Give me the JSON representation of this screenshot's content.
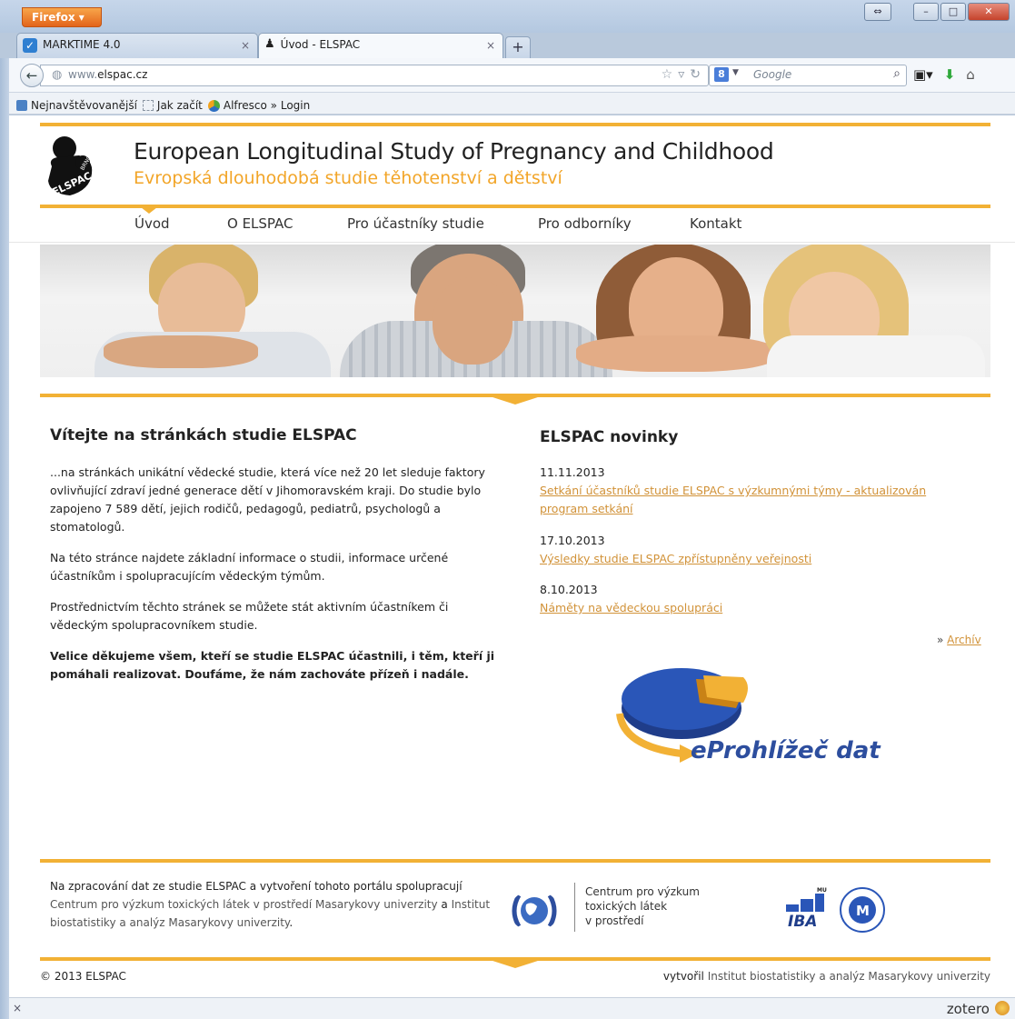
{
  "browser": {
    "app_button": "Firefox",
    "tabs": [
      {
        "label": "MARKTIME 4.0",
        "active": false
      },
      {
        "label": "Úvod - ELSPAC",
        "active": true
      }
    ],
    "new_tab": "+",
    "url_prefix": "www.",
    "url_domain": "elspac.cz",
    "search_placeholder": "Google",
    "bookmarks": [
      "Nejnavštěvovanější",
      "Jak začít",
      "Alfresco » Login"
    ],
    "status_left": "×",
    "status_right": "zotero"
  },
  "site": {
    "logo_text": "ELSPAC BRNO",
    "title_en": "European Longitudinal Study of Pregnancy and Childhood",
    "title_cz": "Evropská dlouhodobá studie těhotenství a dětství",
    "menu": [
      "Úvod",
      "O ELSPAC",
      "Pro účastníky studie",
      "Pro odborníky",
      "Kontakt"
    ],
    "accent_color": "#f2b135"
  },
  "welcome": {
    "heading": "Vítejte na stránkách studie ELSPAC",
    "paragraphs": [
      "...na stránkách unikátní vědecké studie, která více než 20 let sleduje faktory ovlivňující zdraví jedné generace dětí v Jihomoravském kraji. Do studie bylo zapojeno 7 589 dětí, jejich rodičů, pedagogů, pediatrů, psychologů a stomatologů.",
      "Na této stránce najdete základní informace o studii,  informace určené účastníkům i spolupracujícím vědeckým týmům.",
      "Prostřednictvím těchto stránek se můžete stát aktivním účastníkem či vědeckým spolupracovníkem studie."
    ],
    "closing": "Velice děkujeme všem, kteří se studie ELSPAC účastnili, i těm, kteří ji pomáhali realizovat. Doufáme, že nám zachováte přízeň i nadále."
  },
  "news": {
    "heading": "ELSPAC novinky",
    "items": [
      {
        "date": "11.11.2013",
        "title": "Setkání účastníků studie ELSPAC s výzkumnými týmy - aktualizován program setkání"
      },
      {
        "date": "17.10.2013",
        "title": "Výsledky studie ELSPAC zpřístupněny veřejnosti"
      },
      {
        "date": "8.10.2013",
        "title": "Náměty na vědeckou spolupráci"
      }
    ],
    "archive_prefix": "»",
    "archive_label": "Archív",
    "eprohlizec_label": "eProhlížeč dat"
  },
  "footer": {
    "text_before": "Na zpracování dat ze studie ELSPAC a vytvoření tohoto portálu spolupracují",
    "link1": "Centrum pro výzkum toxických látek v prostředí Masarykovy univerzity",
    "text_and": "a",
    "link2": "Institut biostatistiky a analýz Masarykovy univerzity",
    "text_end": ".",
    "cvt_lines": [
      "Centrum pro výzkum",
      "toxických látek",
      "v prostředí"
    ],
    "iba_mu": "MU",
    "iba_label": "IBA",
    "copyright": "© 2013 ELSPAC",
    "credit_prefix": "vytvořil",
    "credit_link": "Institut biostatistiky a analýz Masarykovy univerzity"
  }
}
